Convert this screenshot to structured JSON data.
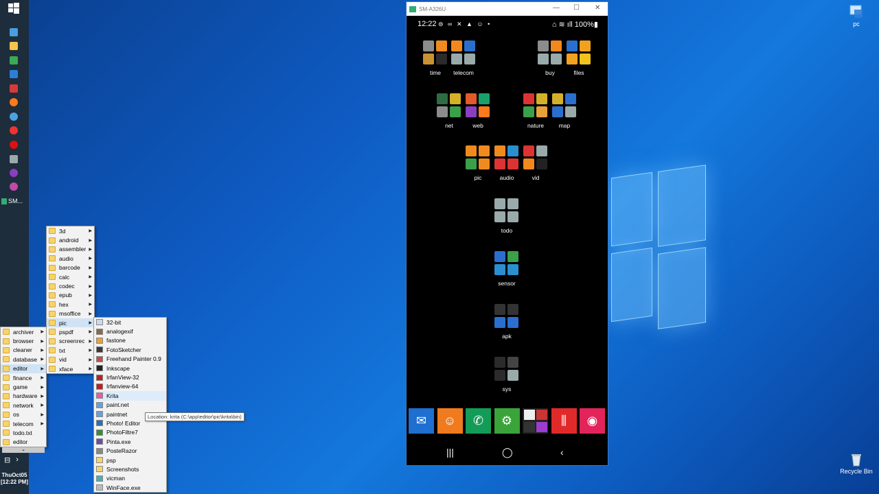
{
  "taskbar": {
    "running_label": "SM...",
    "clock_line1": "ThuOct05",
    "clock_line2": "[12:22 PM]",
    "tray_left": "⊟",
    "tray_right": "›"
  },
  "desktop": {
    "pc_label": "pc",
    "recycle_label": "Recycle Bin"
  },
  "menu1": {
    "items": [
      "archiver",
      "browser",
      "cleaner",
      "database",
      "editor",
      "finance",
      "game",
      "hardware",
      "network",
      "os",
      "telecom",
      "todo.txt",
      "editor"
    ]
  },
  "menu2": {
    "items": [
      "3d",
      "android",
      "assembler",
      "audio",
      "barcode",
      "calc",
      "codec",
      "epub",
      "hex",
      "msoffice",
      "pic",
      "pspdf",
      "screenrec",
      "txt",
      "vid",
      "xface"
    ]
  },
  "menu3": {
    "items": [
      "32-bit",
      "analogexif",
      "fastone",
      "FotoSketcher",
      "Freehand Painter 0.9",
      "Inkscape",
      "IrfanView-32",
      "Irfanview-64",
      "Krita",
      "paint.net",
      "paintnet",
      "Photo! Editor",
      "PhotoFiltre7",
      "Pinta.exe",
      "PosteRazor",
      "psp",
      "Screenshots",
      "vicman",
      "WinFace.exe"
    ]
  },
  "tooltip": "Location: krita (C:\\app\\editor\\pic\\krita\\bin)",
  "phone": {
    "title": "SM-A326U",
    "status_time": "12:22",
    "status_icons": "⊜ ∞ ✕ ▲ ☺ •",
    "status_right": "⌂ ≋ ıll 100%▮",
    "folders": {
      "time": "time",
      "telecom": "telecom",
      "buy": "buy",
      "files": "files",
      "net": "net",
      "web": "web",
      "nature": "nature",
      "map": "map",
      "pic": "pic",
      "audio": "audio",
      "vid": "vid",
      "todo": "todo",
      "sensor": "sensor",
      "apk": "apk",
      "sys": "sys"
    },
    "nav": {
      "recent": "|||",
      "home": "◯",
      "back": "‹"
    }
  }
}
